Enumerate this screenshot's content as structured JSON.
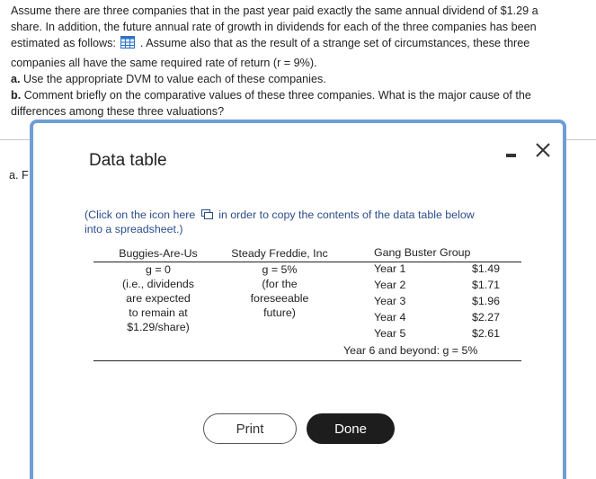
{
  "problem": {
    "line1": "Assume there are three companies that in the past year paid exactly the same annual dividend of $1.29 a",
    "line2": "share. In addition, the future annual rate of growth in dividends for each of the three companies has been",
    "line3_pre": "estimated as follows:",
    "line3_post": ". Assume also that as the result of a strange set of circumstances, these three",
    "line4": "companies all have the same required rate of return (r = 9%).",
    "part_a_letter": "a.",
    "part_a_text": " Use the appropriate DVM to value each of these companies.",
    "part_b_letter": "b.",
    "part_b_text": " Comment briefly on the comparative values of these three companies. What is the major cause of the",
    "part_b_text2": "differences among these three valuations?",
    "answer_a_label": "a. F"
  },
  "modal": {
    "title": "Data table",
    "copy_note_pre": "(Click on the icon here",
    "copy_note_post": "in order to copy the contents of the data table below",
    "copy_note_line2": "into a spreadsheet.)",
    "print_label": "Print",
    "done_label": "Done"
  },
  "table": {
    "col1": {
      "header": "Buggies-Are-Us",
      "lines": [
        "g = 0",
        "(i.e., dividends",
        "are expected",
        "to remain at",
        "$1.29/share)"
      ]
    },
    "col2": {
      "header": "Steady Freddie, Inc",
      "lines": [
        "g = 5%",
        "(for the",
        "foreseeable",
        "future)"
      ]
    },
    "col3": {
      "header": "Gang Buster Group",
      "rows": [
        {
          "year": "Year 1",
          "amount": "$1.49"
        },
        {
          "year": "Year 2",
          "amount": "$1.71"
        },
        {
          "year": "Year 3",
          "amount": "$1.96"
        },
        {
          "year": "Year 4",
          "amount": "$2.27"
        },
        {
          "year": "Year 5",
          "amount": "$2.61"
        }
      ],
      "footer": "Year 6 and beyond: g = 5%"
    }
  }
}
